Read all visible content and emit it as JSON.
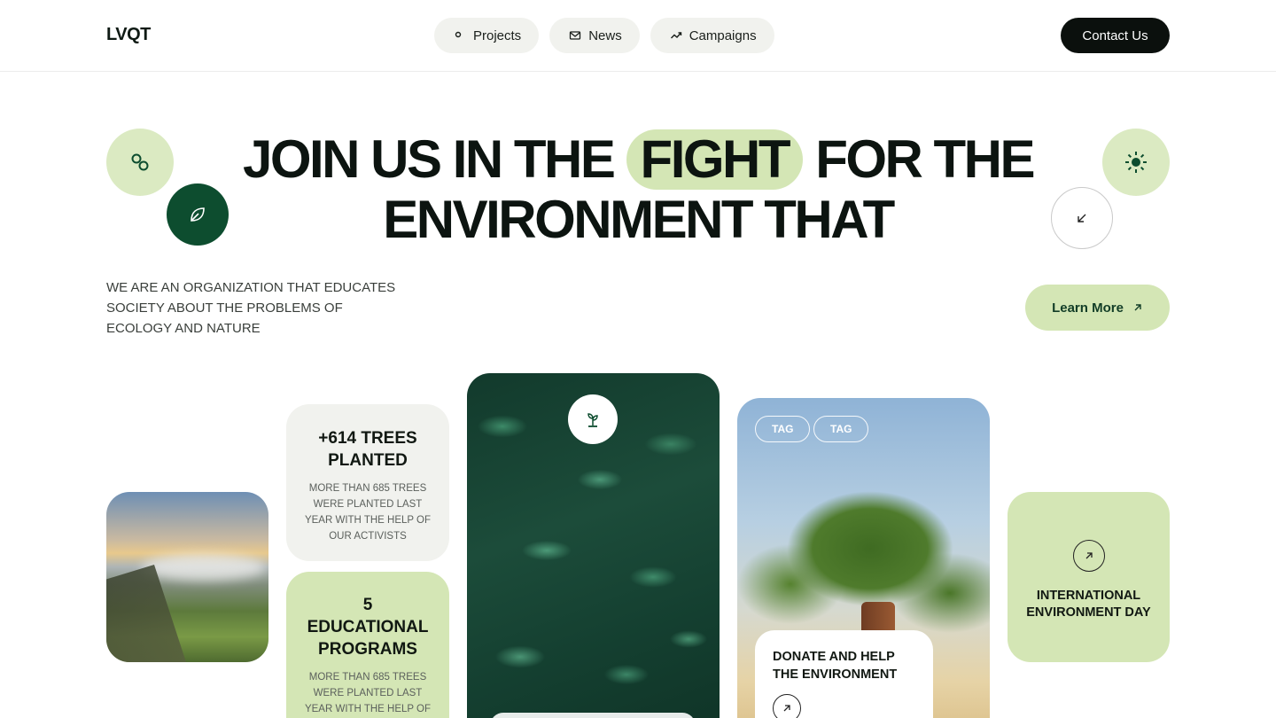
{
  "header": {
    "logo": "LVQT",
    "nav": [
      {
        "label": "Projects",
        "icon": "dot-icon"
      },
      {
        "label": "News",
        "icon": "mail-icon"
      },
      {
        "label": "Campaigns",
        "icon": "trend-icon"
      }
    ],
    "contact_label": "Contact Us"
  },
  "hero": {
    "title_part1": "JOIN US IN THE",
    "title_highlight": "FIGHT",
    "title_part2": "FOR THE",
    "title_line2": "ENVIRONMENT THAT",
    "intro": "WE ARE AN ORGANIZATION THAT EDUCATES SOCIETY ABOUT THE PROBLEMS OF ECOLOGY AND NATURE",
    "learn_more": "Learn More"
  },
  "cards": {
    "stat1": {
      "title": "+614 TREES PLANTED",
      "desc": "MORE THAN 685 TREES WERE PLANTED LAST YEAR WITH THE HELP OF OUR ACTIVISTS"
    },
    "stat2": {
      "title": "5 EDUCATIONAL PROGRAMS",
      "desc": "MORE THAN 685 TREES WERE PLANTED LAST YEAR WITH THE HELP OF"
    },
    "tags": [
      "TAG",
      "TAG"
    ],
    "donate_title": "DONATE AND HELP THE ENVIRONMENT",
    "env_day_title": "INTERNATIONAL ENVIRONMENT DAY"
  },
  "colors": {
    "accent_light": "#d4e6b5",
    "accent_dark": "#0d4d2f",
    "text_dark": "#0c1410"
  }
}
